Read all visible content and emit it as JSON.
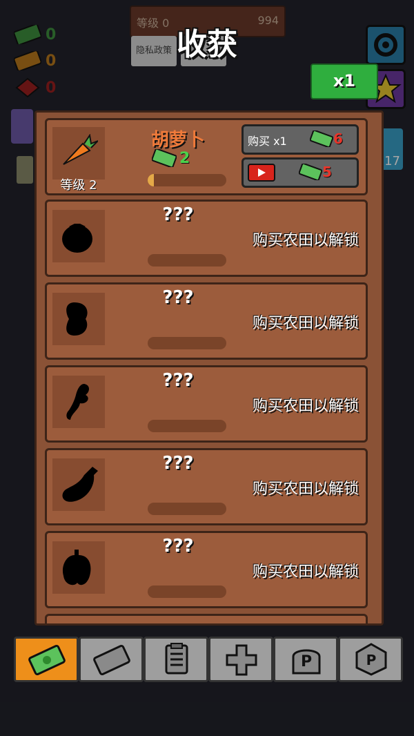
{
  "hud": {
    "cash": "0",
    "tickets": "0",
    "gems": "0",
    "level_label": "等级 0",
    "level_value": "994",
    "privacy_label": "隐私政策",
    "side_badge": "17"
  },
  "screen_title": "收获",
  "multiplier_label": "x1",
  "crops": [
    {
      "name": "胡萝卜",
      "level_label": "等级 2",
      "income": "2",
      "progress": 0.08,
      "buy_label": "购买 x1",
      "buy_cost": "6",
      "ad_cost": "5",
      "unlocked": true
    },
    {
      "name": "???",
      "lock_text": "购买农田以解锁",
      "unlocked": false,
      "icon": "tomato-silhouette-icon"
    },
    {
      "name": "???",
      "lock_text": "购买农田以解锁",
      "unlocked": false,
      "icon": "potato-silhouette-icon"
    },
    {
      "name": "???",
      "lock_text": "购买农田以解锁",
      "unlocked": false,
      "icon": "ginger-silhouette-icon"
    },
    {
      "name": "???",
      "lock_text": "购买农田以解锁",
      "unlocked": false,
      "icon": "eggplant-silhouette-icon"
    },
    {
      "name": "???",
      "lock_text": "购买农田以解锁",
      "unlocked": false,
      "icon": "pepper-silhouette-icon"
    }
  ],
  "tabs": [
    {
      "name": "harvest",
      "icon": "cash-icon",
      "active": true
    },
    {
      "name": "tickets",
      "icon": "ticket-icon",
      "active": false
    },
    {
      "name": "tasks",
      "icon": "clipboard-icon",
      "active": false
    },
    {
      "name": "boost",
      "icon": "plus-icon",
      "active": false
    },
    {
      "name": "prestige",
      "icon": "p-stone-icon",
      "active": false
    },
    {
      "name": "prestige-shop",
      "icon": "p-coin-icon",
      "active": false
    }
  ],
  "colors": {
    "accent_green": "#2fae3e",
    "active_tab": "#ee8f1a",
    "panel_brown": "#8a5236",
    "price_red": "#e8352a"
  }
}
